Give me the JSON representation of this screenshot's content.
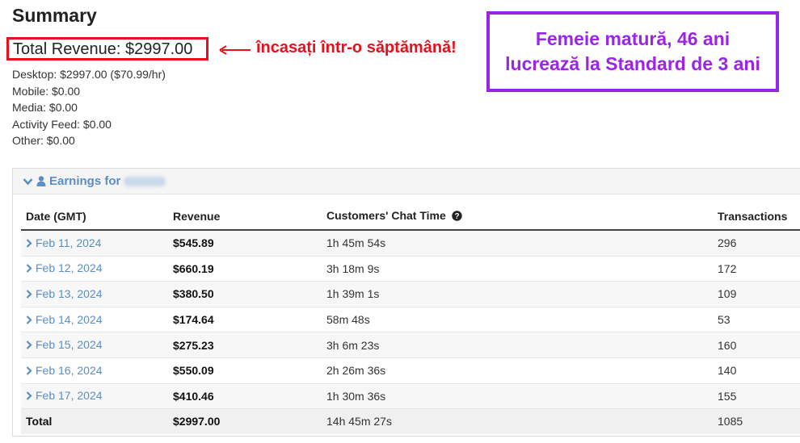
{
  "summary": {
    "title": "Summary",
    "total_revenue": "Total Revenue: $2997.00",
    "breakdown": {
      "desktop": "Desktop: $2997.00 ($70.99/hr)",
      "mobile": "Mobile: $0.00",
      "media": "Media: $0.00",
      "activity_feed": "Activity Feed: $0.00",
      "other": "Other: $0.00"
    }
  },
  "annotations": {
    "red_callout": "încasați într-o săptămână!",
    "purple_line1": "Femeie matură, 46 ani",
    "purple_line2": "lucrează la Standard de 3 ani",
    "colors": {
      "red": "#e8101a",
      "purple": "#9a25e8"
    }
  },
  "earnings": {
    "header": "Earnings for",
    "icons": [
      "chevron-down-icon",
      "user-icon"
    ],
    "columns": [
      "Date (GMT)",
      "Revenue",
      "Customers' Chat Time",
      "Transactions"
    ],
    "rows": [
      {
        "date": "Feb 11, 2024",
        "revenue": "$545.89",
        "chat_time": "1h 45m 54s",
        "transactions": "296"
      },
      {
        "date": "Feb 12, 2024",
        "revenue": "$660.19",
        "chat_time": "3h 18m 9s",
        "transactions": "172"
      },
      {
        "date": "Feb 13, 2024",
        "revenue": "$380.50",
        "chat_time": "1h 39m 1s",
        "transactions": "109"
      },
      {
        "date": "Feb 14, 2024",
        "revenue": "$174.64",
        "chat_time": "58m 48s",
        "transactions": "53"
      },
      {
        "date": "Feb 15, 2024",
        "revenue": "$275.23",
        "chat_time": "3h 6m 23s",
        "transactions": "160"
      },
      {
        "date": "Feb 16, 2024",
        "revenue": "$550.09",
        "chat_time": "2h 26m 36s",
        "transactions": "140"
      },
      {
        "date": "Feb 17, 2024",
        "revenue": "$410.46",
        "chat_time": "1h 30m 36s",
        "transactions": "155"
      }
    ],
    "total": {
      "label": "Total",
      "revenue": "$2997.00",
      "chat_time": "14h 45m 27s",
      "transactions": "1085"
    },
    "link_color": "#5b8fc3"
  }
}
